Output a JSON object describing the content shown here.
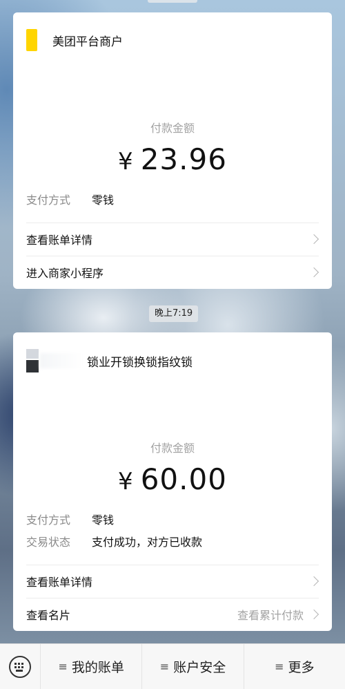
{
  "chat": {
    "card1": {
      "merchant_name": "美团平台商户",
      "pay_label": "付款金额",
      "currency": "¥",
      "amount": "23.96",
      "method_label": "支付方式",
      "method_value": "零钱",
      "rows": [
        {
          "label": "查看账单详情"
        },
        {
          "label": "进入商家小程序"
        }
      ]
    },
    "timestamp": "晚上7:19",
    "card2": {
      "merchant_name": "锁业开锁换锁指纹锁",
      "pay_label": "付款金额",
      "currency": "¥",
      "amount": "60.00",
      "method_label": "支付方式",
      "method_value": "零钱",
      "status_label": "交易状态",
      "status_value": "支付成功，对方已收款",
      "rows": [
        {
          "label": "查看账单详情",
          "extra": ""
        },
        {
          "label": "查看名片",
          "extra": "查看累计付款"
        }
      ]
    }
  },
  "bottom_menu": {
    "keyboard_icon": "keyboard-icon",
    "items": [
      {
        "icon": "≡",
        "label": "我的账单"
      },
      {
        "icon": "≡",
        "label": "账户安全"
      },
      {
        "icon": "≡",
        "label": "更多"
      }
    ]
  },
  "colors": {
    "merchant_logo": "#ffd500",
    "card_bg": "#ffffff",
    "muted_text": "#a3a3a3"
  }
}
